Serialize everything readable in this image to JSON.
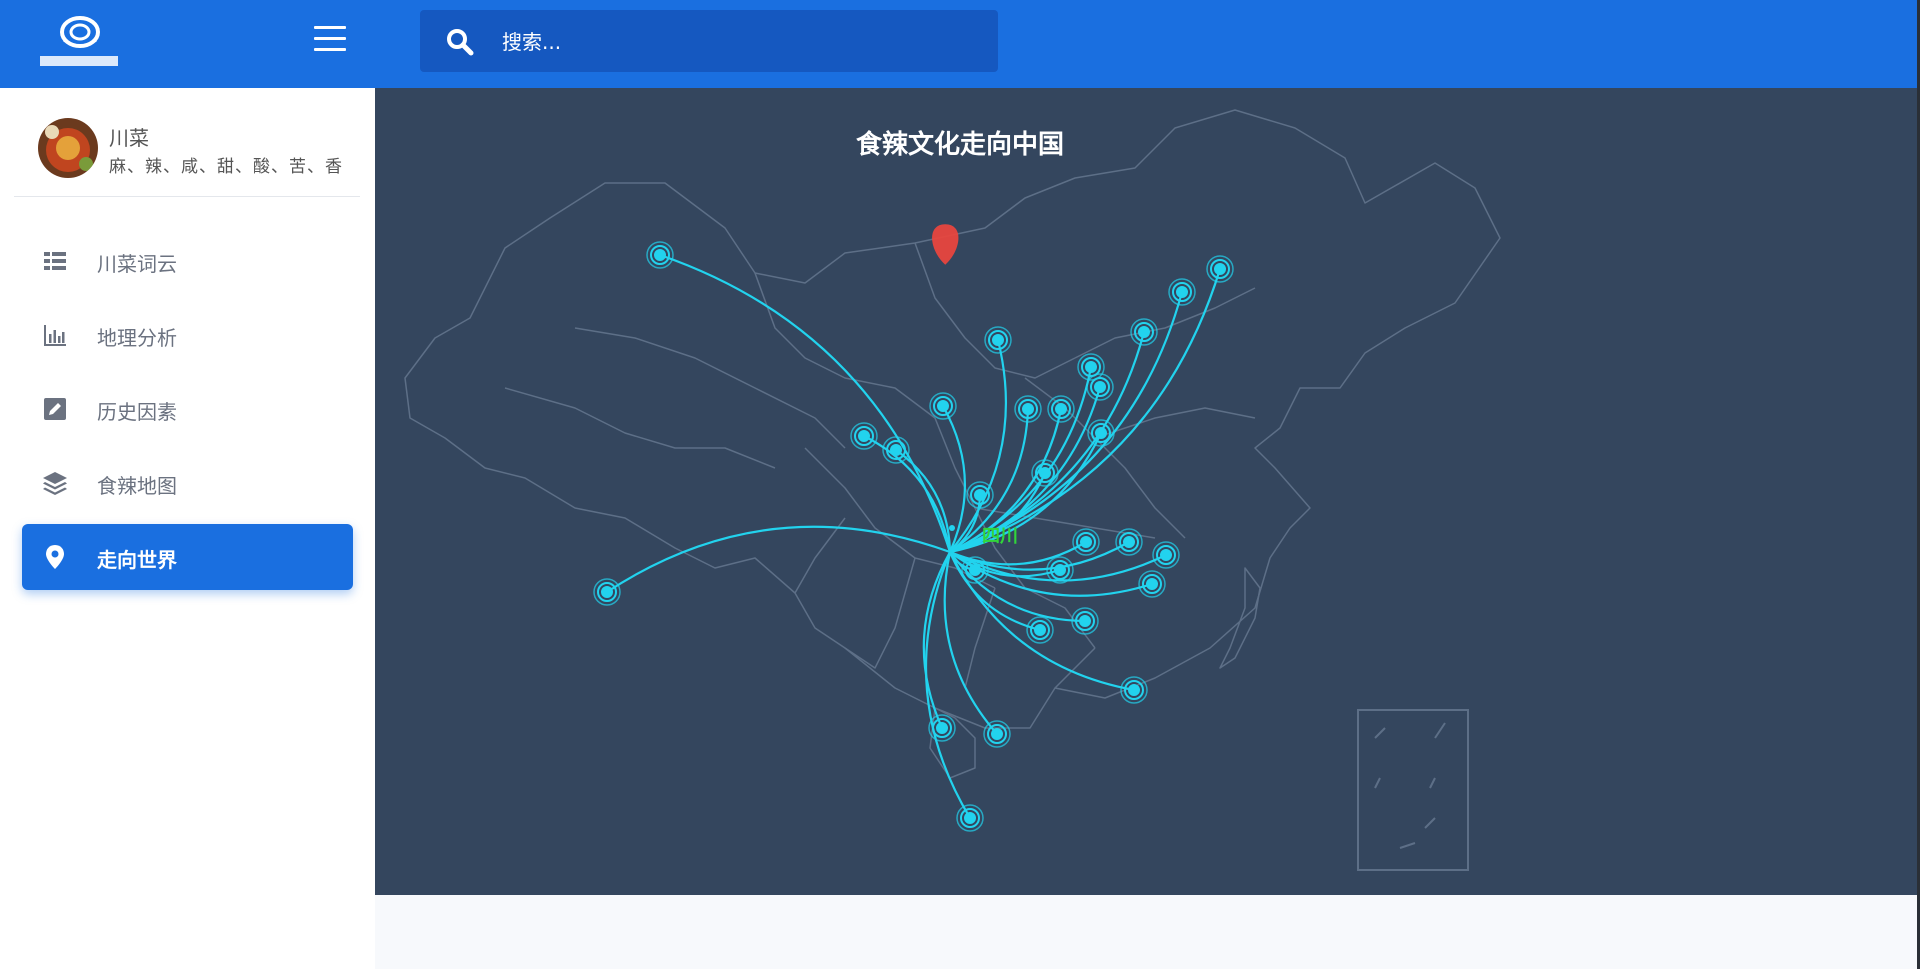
{
  "brand": {
    "logo_icon": "brand-logo"
  },
  "header": {
    "menu_icon": "hamburger-icon"
  },
  "search": {
    "placeholder": "搜索..."
  },
  "profile": {
    "name": "川菜",
    "desc": "麻、辣、咸、甜、酸、苦、香"
  },
  "nav": {
    "items": [
      {
        "label": "川菜词云",
        "icon": "list-icon",
        "active": false
      },
      {
        "label": "地理分析",
        "icon": "bar-chart-icon",
        "active": false
      },
      {
        "label": "历史因素",
        "icon": "edit-icon",
        "active": false
      },
      {
        "label": "食辣地图",
        "icon": "layers-icon",
        "active": false
      },
      {
        "label": "走向世界",
        "icon": "map-pin-icon",
        "active": true
      }
    ]
  },
  "map": {
    "title": "食辣文化走向中国",
    "origin_label": "四川",
    "colors": {
      "flow": "#22d3ee",
      "origin": "#e8463e",
      "origin_label": "#31d63a",
      "background": "#34465e"
    }
  }
}
